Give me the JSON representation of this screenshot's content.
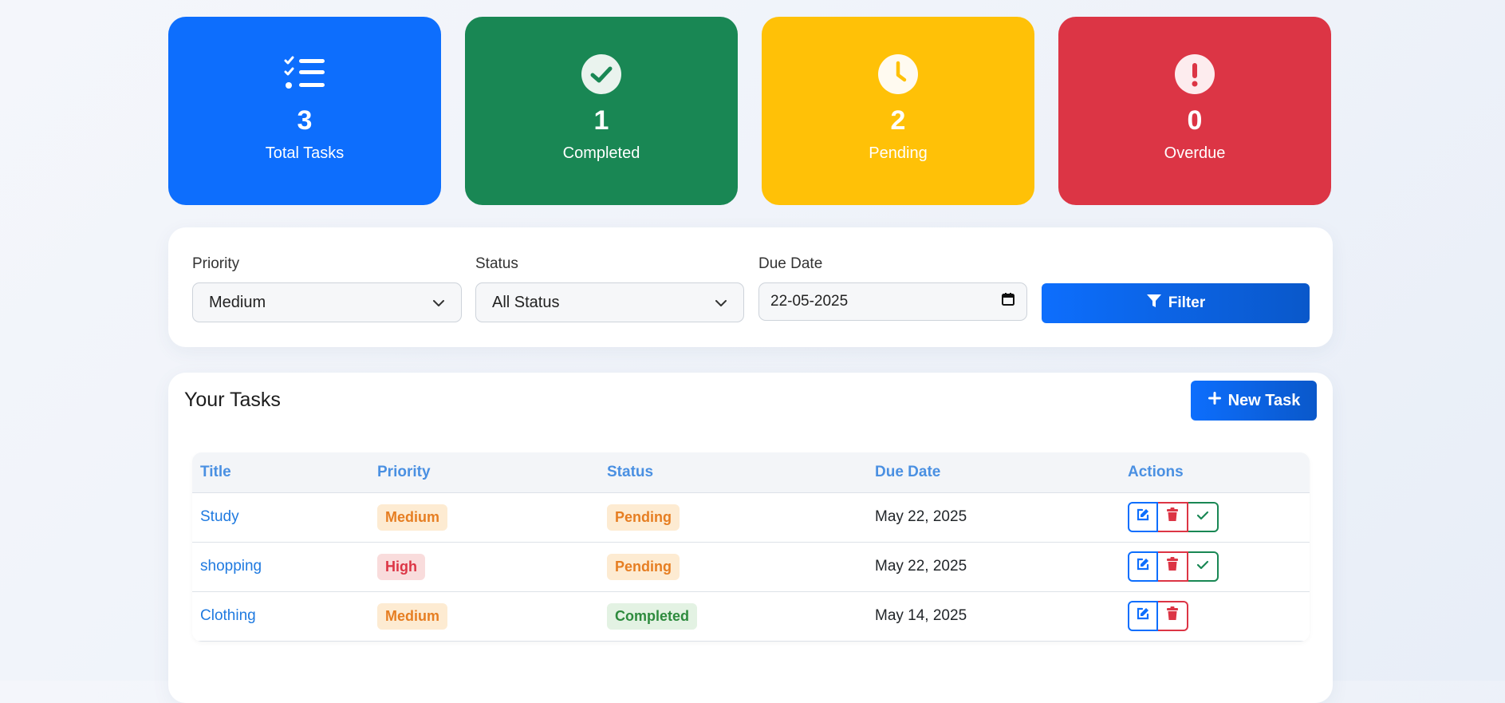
{
  "stats": {
    "total": {
      "value": "3",
      "label": "Total Tasks",
      "color": "#0d6efd",
      "icon": "list-check-icon"
    },
    "completed": {
      "value": "1",
      "label": "Completed",
      "color": "#198754",
      "icon": "check-circle-icon"
    },
    "pending": {
      "value": "2",
      "label": "Pending",
      "color": "#ffc107",
      "icon": "clock-icon"
    },
    "overdue": {
      "value": "0",
      "label": "Overdue",
      "color": "#dc3545",
      "icon": "exclamation-circle-icon"
    }
  },
  "filters": {
    "priority": {
      "label": "Priority",
      "value": "Medium"
    },
    "status": {
      "label": "Status",
      "value": "All Status"
    },
    "due_date": {
      "label": "Due Date",
      "value": "22-05-2025"
    },
    "button_label": "Filter"
  },
  "tasks": {
    "title": "Your Tasks",
    "new_task_label": "New Task",
    "columns": [
      "Title",
      "Priority",
      "Status",
      "Due Date",
      "Actions"
    ],
    "rows": [
      {
        "title": "Study",
        "priority": "Medium",
        "status": "Pending",
        "due": "May 22, 2025"
      },
      {
        "title": "shopping",
        "priority": "High",
        "status": "Pending",
        "due": "May 22, 2025"
      },
      {
        "title": "Clothing",
        "priority": "Medium",
        "status": "Completed",
        "due": "May 14, 2025"
      }
    ]
  }
}
